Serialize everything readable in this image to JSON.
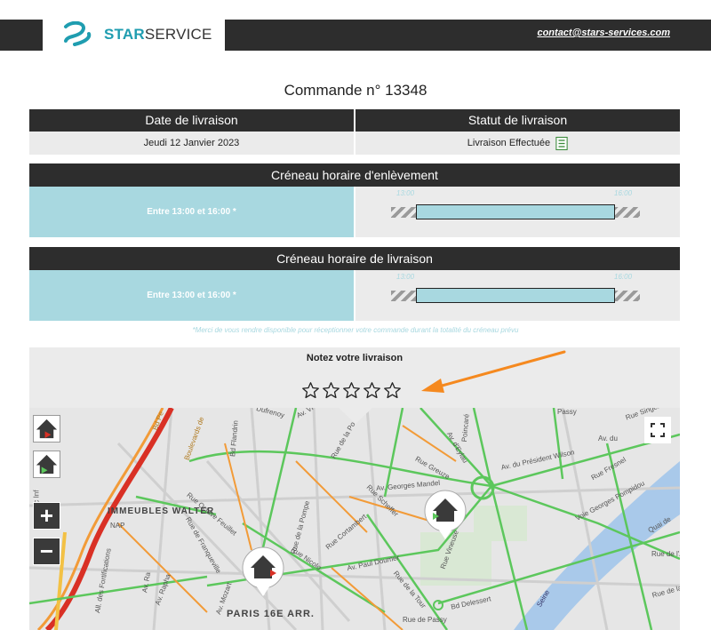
{
  "brand": {
    "name_bold": "STAR",
    "name_regular": "SERVICE",
    "accent": "#1f9db0"
  },
  "header": {
    "contact_email": "contact@stars-services.com"
  },
  "order": {
    "title": "Commande n° 13348"
  },
  "delivery_info": {
    "date_header": "Date de livraison",
    "date_value": "Jeudi 12 Janvier 2023",
    "status_header": "Statut de livraison",
    "status_value": "Livraison Effectuée",
    "status_icon": "checklist-icon"
  },
  "pickup_slot": {
    "header": "Créneau horaire d'enlèvement",
    "label": "Entre 13:00 et 16:00 *",
    "start": "13:00",
    "end": "16:00"
  },
  "delivery_slot": {
    "header": "Créneau horaire de livraison",
    "label": "Entre 13:00 et 16:00 *",
    "start": "13:00",
    "end": "16:00"
  },
  "note": "*Merci de vous rendre disponible pour réceptionner votre commande durant la totalité du créneau prévu",
  "rating": {
    "title": "Notez votre livraison",
    "max_stars": 5,
    "current": 0
  },
  "map": {
    "district": "PARIS 16E ARR.",
    "area": "IMMEUBLES WALTER",
    "nap": "NAP",
    "streets": [
      "Av. Georges Mandel",
      "Av. du Président Wilson",
      "Av. Paul Doumer",
      "Bd Delessert",
      "Rue de Passy",
      "Voie Georges Pompidou",
      "Rue de la Pompe",
      "Bd Flandrin",
      "Boulevards de",
      "Rue Scheffer",
      "Seine",
      "Quai de",
      "Rue de la Tour",
      "Rue Nicolo",
      "Rue Octave Feuillet",
      "Rue Greuze",
      "Poincaré",
      "Av. du",
      "Rue de Franqueville",
      "Lac Inf",
      "Bd Pe",
      "Av. d'Eylau",
      "Dufrenoy",
      "Rue Vineuse",
      "Av. Vi",
      "Rue Fresnel",
      "All. des Fortifications",
      "Rue Cortambert",
      "Av. Ra",
      "Av. Rapha",
      "Rue de la Po",
      "Rue de l'A",
      "Passy",
      "Rue Singer",
      "Av. Mozart",
      "Rue de la Tour"
    ]
  },
  "colors": {
    "dark": "#2d2d2d",
    "slot_blue": "#a8d8e0",
    "panel": "#ebebeb"
  }
}
